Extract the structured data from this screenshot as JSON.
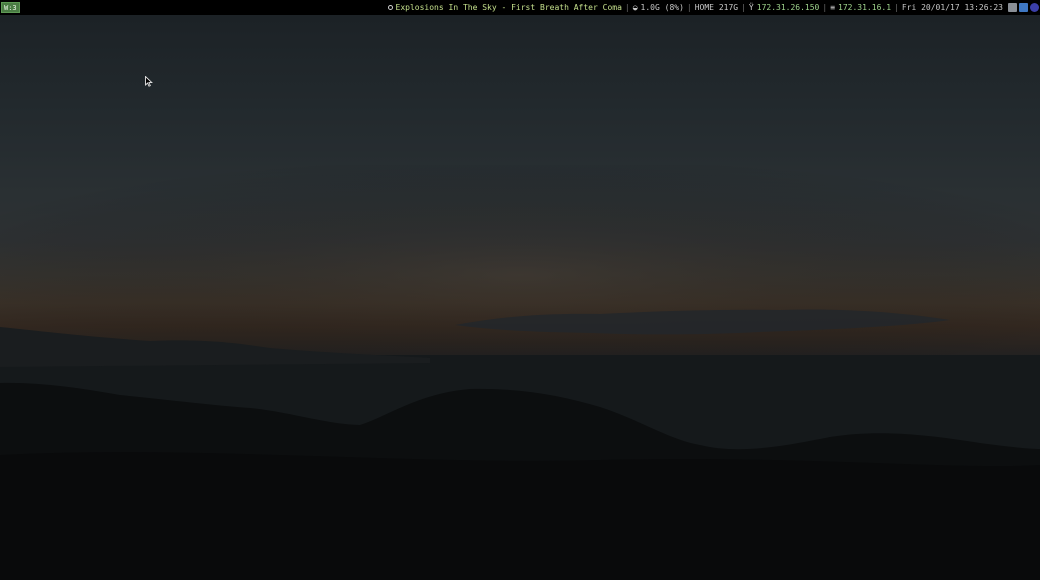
{
  "workspace": {
    "label": "W:3"
  },
  "status": {
    "now_playing": "Explosions In The Sky - First Breath After Coma",
    "swap": "1.0G (8%)",
    "disk": "HOME 217G",
    "wifi_ip": "172.31.26.150",
    "eth_ip": "172.31.16.1",
    "datetime": "Fri 20/01/17 13:26:23"
  },
  "tray": {
    "icons": [
      "app-tray-icon",
      "network-tray-icon",
      "bluetooth-tray-icon"
    ]
  },
  "colors": {
    "workspace_bg": "#4a7c44",
    "accent_green": "#9fd38c",
    "bar_bg": "#000000"
  }
}
